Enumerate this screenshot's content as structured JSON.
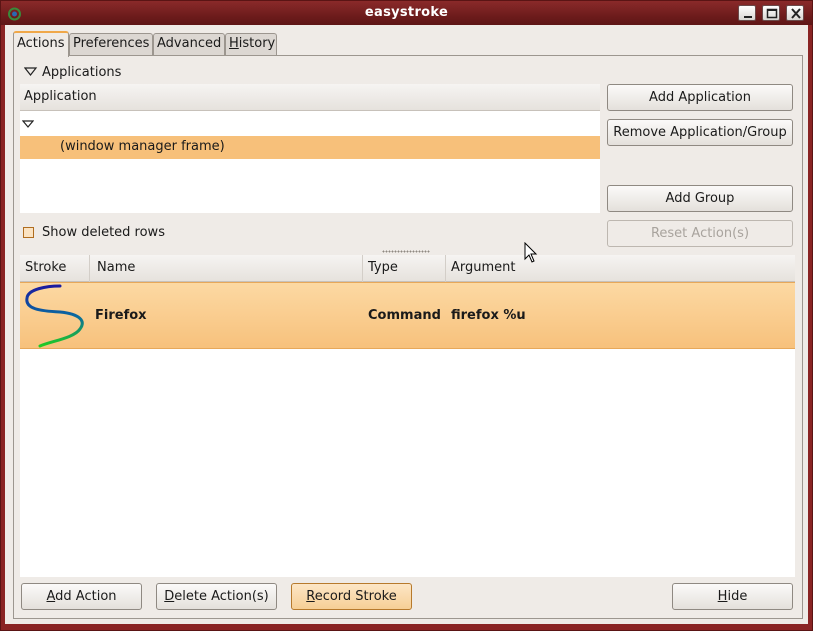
{
  "window": {
    "title": "easystroke"
  },
  "tabs": [
    {
      "label": "Actions",
      "active": true
    },
    {
      "label": "Preferences",
      "active": false
    },
    {
      "label": "Advanced",
      "active": false
    },
    {
      "label": "History",
      "active": false
    }
  ],
  "applications": {
    "expander_label": "Applications",
    "column_header": "Application",
    "rows": [
      {
        "label": ""
      },
      {
        "label": "(window manager frame)",
        "selected": true
      }
    ]
  },
  "side_buttons": {
    "add_application": "Add Application",
    "remove_application": "Remove Application/Group",
    "add_group": "Add Group",
    "reset_actions": "Reset Action(s)"
  },
  "show_deleted": {
    "label": "Show deleted rows",
    "checked": false
  },
  "actions_table": {
    "columns": [
      "Stroke",
      "Name",
      "Type",
      "Argument"
    ],
    "rows": [
      {
        "stroke": "s-shaped-stroke-icon",
        "name": "Firefox",
        "type": "Command",
        "argument": "firefox %u",
        "selected": true
      }
    ]
  },
  "bottom_buttons": {
    "add_action": {
      "prefix": "",
      "mnemonic": "A",
      "suffix": "dd Action"
    },
    "delete_actions": {
      "prefix": "",
      "mnemonic": "D",
      "suffix": "elete Action(s)"
    },
    "record_stroke": {
      "prefix": "",
      "mnemonic": "R",
      "suffix": "ecord Stroke"
    },
    "hide": {
      "prefix": "",
      "mnemonic": "H",
      "suffix": "ide"
    }
  },
  "tab_mnemonics": {
    "history_mnemonic": "H",
    "history_suffix": "istory"
  },
  "colors": {
    "titlebar": "#7a2020",
    "selection": "#f7c07a",
    "accent": "#f0a849"
  }
}
